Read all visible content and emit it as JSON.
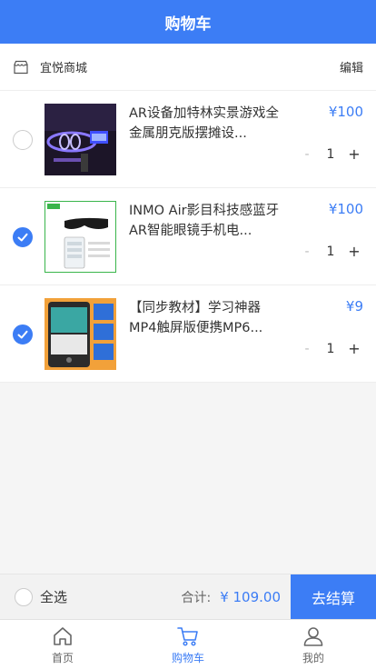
{
  "header": {
    "title": "购物车"
  },
  "shop": {
    "name": "宜悦商城",
    "edit": "编辑"
  },
  "items": [
    {
      "title": "AR设备加特林实景游戏全金属朋克版摆摊设...",
      "price": "¥100",
      "qty": "1",
      "checked": false
    },
    {
      "title": "INMO Air影目科技感蓝牙AR智能眼镜手机电...",
      "price": "¥100",
      "qty": "1",
      "checked": true
    },
    {
      "title": "【同步教材】学习神器MP4触屏版便携MP6...",
      "price": "¥9",
      "qty": "1",
      "checked": true
    }
  ],
  "stepper": {
    "minus": "-",
    "plus": "+"
  },
  "footer": {
    "select_all": "全选",
    "total_label": "合计:",
    "total_value": "¥ 109.00",
    "checkout": "去结算"
  },
  "tabs": [
    {
      "label": "首页",
      "icon": "home-icon"
    },
    {
      "label": "购物车",
      "icon": "cart-icon",
      "active": true
    },
    {
      "label": "我的",
      "icon": "user-icon"
    }
  ],
  "colors": {
    "accent": "#3c7df5"
  }
}
